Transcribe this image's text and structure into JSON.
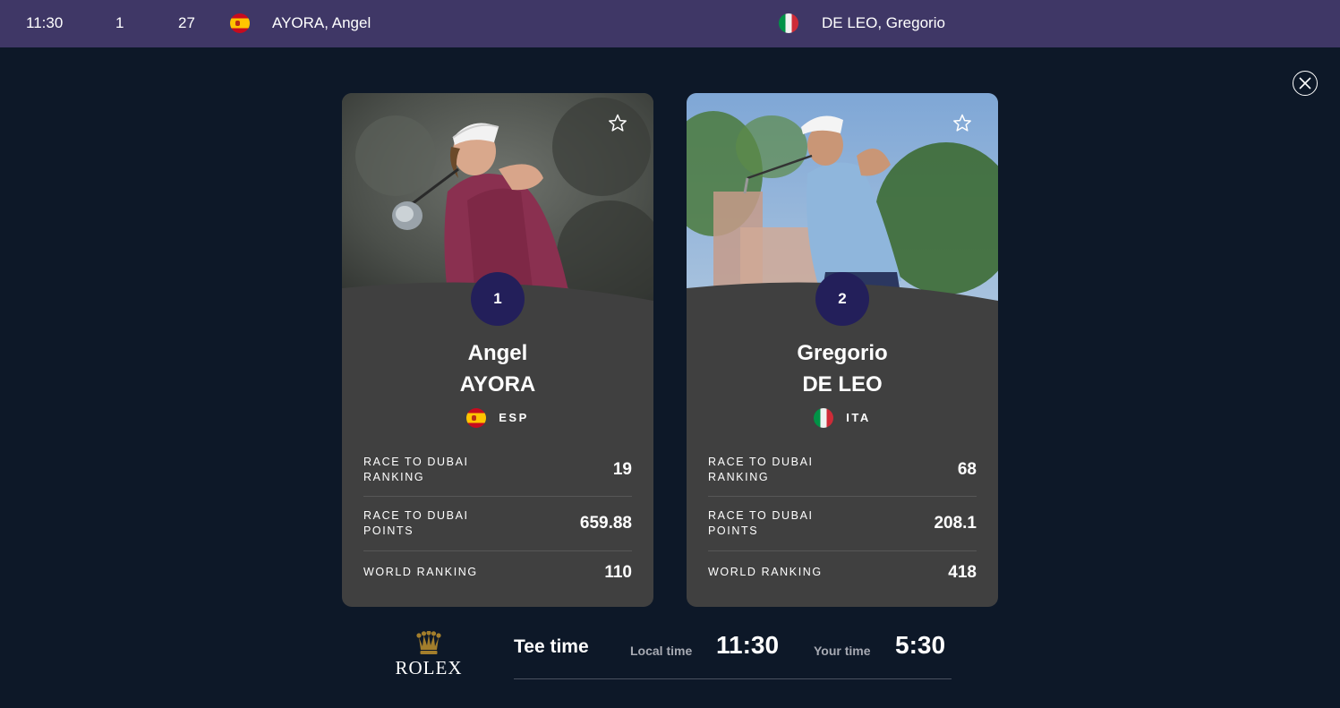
{
  "top_bar": {
    "time": "11:30",
    "group": "1",
    "tee": "27",
    "player1": "AYORA, Angel",
    "player1_flag": "spain-flag-icon",
    "player2": "DE LEO, Gregorio",
    "player2_flag": "italy-flag-icon"
  },
  "close_icon": "close-icon",
  "players": [
    {
      "number": "1",
      "first_name": "Angel",
      "last_name": "AYORA",
      "country": "ESP",
      "flag": "spain-flag-icon",
      "stats": [
        {
          "label_line1": "RACE TO DUBAI",
          "label_line2": "RANKING",
          "value": "19"
        },
        {
          "label_line1": "RACE TO DUBAI",
          "label_line2": "POINTS",
          "value": "659.88"
        },
        {
          "label_line1": "WORLD RANKING",
          "label_line2": "",
          "value": "110"
        }
      ]
    },
    {
      "number": "2",
      "first_name": "Gregorio",
      "last_name": "DE LEO",
      "country": "ITA",
      "flag": "italy-flag-icon",
      "stats": [
        {
          "label_line1": "RACE TO DUBAI",
          "label_line2": "RANKING",
          "value": "68"
        },
        {
          "label_line1": "RACE TO DUBAI",
          "label_line2": "POINTS",
          "value": "208.1"
        },
        {
          "label_line1": "WORLD RANKING",
          "label_line2": "",
          "value": "418"
        }
      ]
    }
  ],
  "tee_time": {
    "sponsor": "ROLEX",
    "title": "Tee time",
    "local_label": "Local time",
    "local_value": "11:30",
    "your_label": "Your time",
    "your_value": "5:30"
  },
  "colors": {
    "page_background": "#0d1828",
    "top_bar": "#3f3766",
    "card": "#404040",
    "badge": "#231f5a",
    "rolex_gold": "#a37e2c"
  }
}
